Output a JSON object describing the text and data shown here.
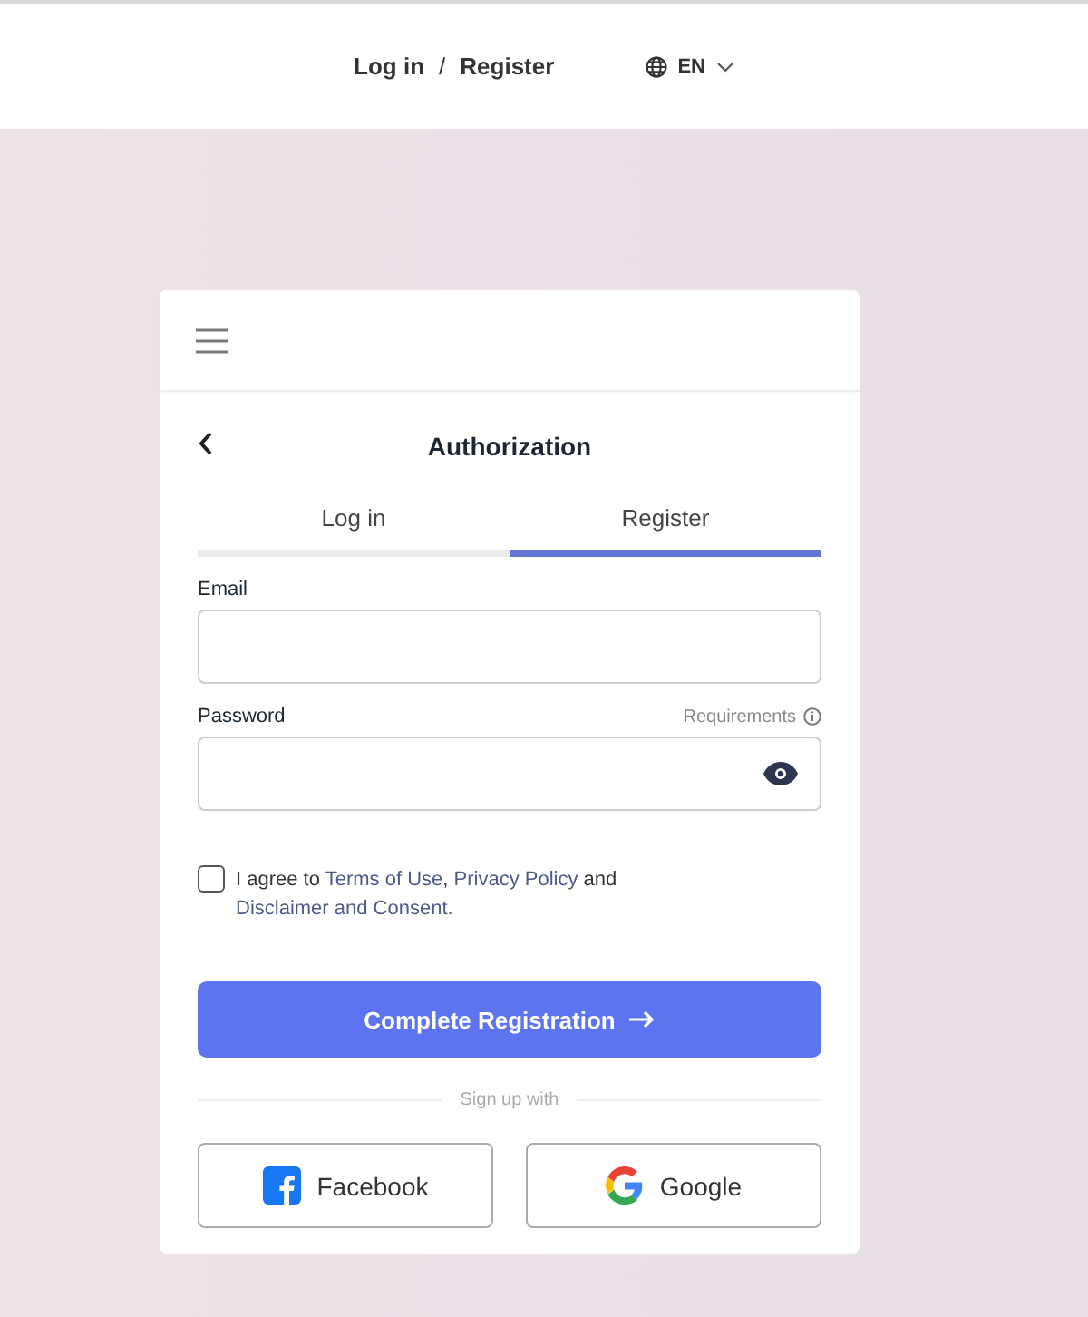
{
  "top_bar": {
    "login_link": "Log in",
    "separator": "/",
    "register_link": "Register",
    "language": "EN"
  },
  "card": {
    "title": "Authorization",
    "tabs": [
      {
        "label": "Log in",
        "selected": false
      },
      {
        "label": "Register",
        "selected": true
      }
    ],
    "fields": [
      {
        "label": "Email",
        "kind": "text"
      },
      {
        "label": "Password",
        "kind": "password",
        "hint_link": "Requirements"
      }
    ],
    "agreement": {
      "checked": false,
      "parts": [
        {
          "kind": "text",
          "text": "I agree to "
        },
        {
          "kind": "link",
          "text": "Terms of Use"
        },
        {
          "kind": "text",
          "text": ","
        },
        {
          "kind": "link",
          "text": " Privacy Policy "
        },
        {
          "kind": "text",
          "text": "and "
        },
        {
          "kind": "link",
          "text": "Disclaimer and Consent."
        }
      ]
    },
    "submit": "Complete Registration",
    "divider": "Sign up with",
    "social": [
      {
        "kind": "facebook",
        "label": "Facebook"
      },
      {
        "kind": "google",
        "label": "Google"
      }
    ]
  }
}
